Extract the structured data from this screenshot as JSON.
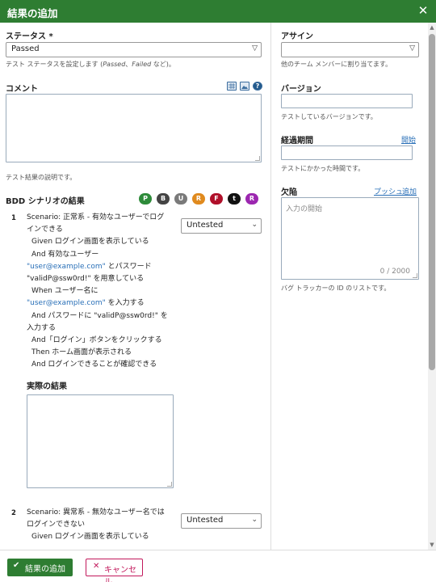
{
  "dialog": {
    "title": "結果の追加",
    "close_icon": "close-icon"
  },
  "status": {
    "label": "ステータス *",
    "value": "Passed",
    "help_prefix": "テスト ステータスを設定します (",
    "help_passed": "Passed",
    "help_sep": "、",
    "help_failed": "Failed",
    "help_suffix": " など)。"
  },
  "comment": {
    "label": "コメント",
    "help": "テスト結果の説明です。",
    "icons": [
      "table-icon",
      "image-icon",
      "help-icon"
    ]
  },
  "bdd": {
    "title": "BDD シナリオの結果",
    "badges": [
      {
        "letter": "P",
        "color": "#2e8b3a"
      },
      {
        "letter": "B",
        "color": "#444444"
      },
      {
        "letter": "U",
        "color": "#7a7a7a"
      },
      {
        "letter": "R",
        "color": "#e08a1e"
      },
      {
        "letter": "F",
        "color": "#b0102a"
      },
      {
        "letter": "t",
        "color": "#111111"
      },
      {
        "letter": "R",
        "color": "#9c27b0"
      }
    ],
    "scenarios": [
      {
        "number": "1",
        "result": "Untested",
        "line1": "Scenario: 正常系 - 有効なユーザーでログ",
        "line2": "インできる",
        "line3": "Given ログイン画面を表示している",
        "line4": "And 有効なユーザー",
        "line5_link": "\"user@example.com\"",
        "line5_rest": " とパスワード",
        "line6": "\"validP@ssw0rd!\" を用意している",
        "line7": "When ユーザー名に",
        "line8_link": "\"user@example.com\"",
        "line8_rest": " を入力する",
        "line9": "And パスワードに \"validP@ssw0rd!\" を",
        "line10": "入力する",
        "line11": "And「ログイン」ボタンをクリックする",
        "line12": "Then ホーム画面が表示される",
        "line13": "And ログインできることが確認できる",
        "actual_label": "実際の結果"
      },
      {
        "number": "2",
        "result": "Untested",
        "line1": "Scenario: 異常系 - 無効なユーザー名では",
        "line2": "ログインできない",
        "line3": "Given ログイン画面を表示している"
      }
    ]
  },
  "assign": {
    "label": "アサイン",
    "value": "",
    "help": "他のチーム メンバーに割り当てます。"
  },
  "version": {
    "label": "バージョン",
    "value": "",
    "help": "テストしているバージョンです。"
  },
  "elapsed": {
    "label": "経過期間",
    "link": "開始",
    "value": "",
    "help": "テストにかかった時間です。"
  },
  "defects": {
    "label": "欠陥",
    "push_link": "プッシュ",
    "add_link": "追加",
    "placeholder": "入力の開始",
    "counter": "0 / 2000",
    "help": "バグ トラッカーの ID のリストです。"
  },
  "footer": {
    "submit_label": "結果の追加",
    "cancel_label": "キャンセル"
  },
  "colors": {
    "brand": "#2e7d32",
    "cancel": "#c2185b",
    "link": "#2a70b8"
  }
}
